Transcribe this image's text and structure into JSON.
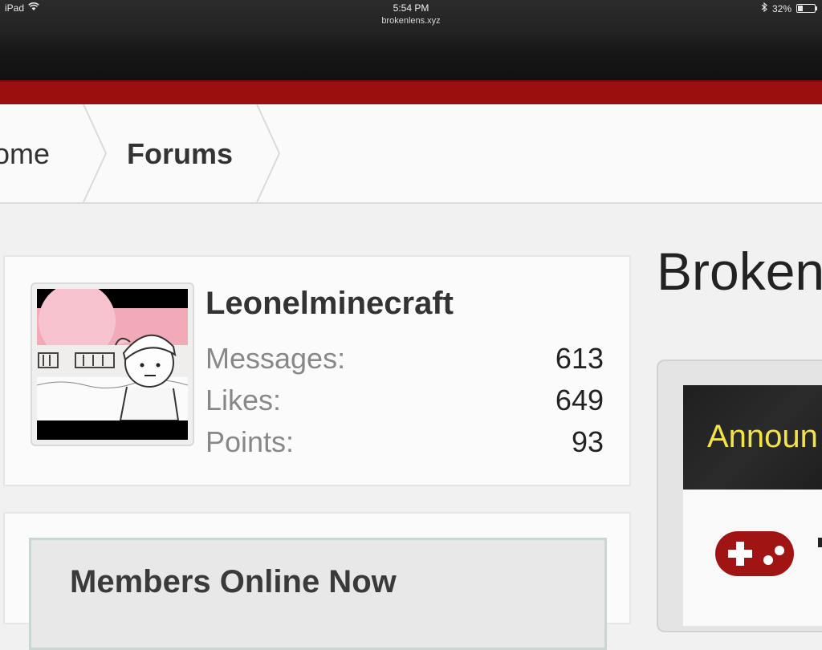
{
  "status_bar": {
    "device": "iPad",
    "time": "5:54 PM",
    "url": "brokenlens.xyz",
    "battery": "32%",
    "battery_level": 0.32
  },
  "breadcrumb": {
    "items": [
      "ome",
      "Forums"
    ]
  },
  "profile": {
    "username": "Leonelminecraft",
    "stats": [
      {
        "label": "Messages:",
        "value": "613"
      },
      {
        "label": "Likes:",
        "value": "649"
      },
      {
        "label": "Points:",
        "value": "93"
      }
    ]
  },
  "members_online": {
    "title": "Members Online Now"
  },
  "site": {
    "title": "Broken"
  },
  "announcements": {
    "title": "Announ"
  },
  "colors": {
    "brand_red": "#9b0f0f",
    "announcement_yellow": "#f4e24a",
    "gamepad_red": "#a01414"
  }
}
